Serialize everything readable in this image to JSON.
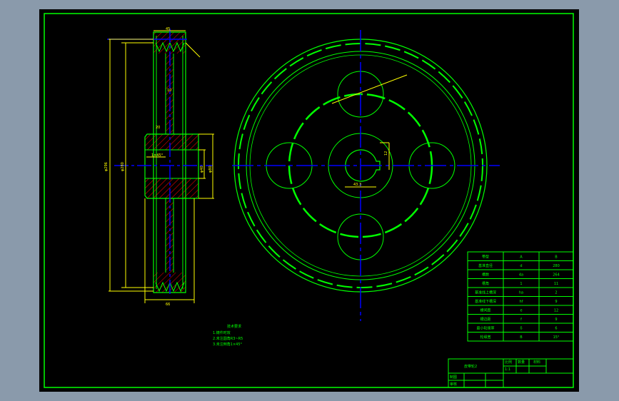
{
  "colors": {
    "background": "#8a9aab",
    "canvas": "#000000",
    "outline": "#00ff00",
    "dimension": "#ffff00",
    "centerline": "#0000ff",
    "hatch": "#ff0000"
  },
  "notes": {
    "title": "技术要求",
    "lines": [
      "1.铸件时效",
      "2.未注圆角R3~R5",
      "3.未注倒角1×45°"
    ]
  },
  "param_table": {
    "rows": [
      [
        "带型",
        "A",
        "B"
      ],
      [
        "基准直径",
        "d",
        "280"
      ],
      [
        "槽数",
        "4a",
        "264"
      ],
      [
        "槽角",
        "1",
        "11"
      ],
      [
        "基准线上槽深",
        "ha",
        "2"
      ],
      [
        "基准线下槽深",
        "hf",
        "9"
      ],
      [
        "槽间距",
        "e",
        "12"
      ],
      [
        "槽边距",
        "f",
        "9"
      ],
      [
        "最小轮缘厚",
        "δ",
        "6"
      ],
      [
        "轮缘宽",
        "B",
        "15°"
      ]
    ]
  },
  "title_block": {
    "name": "皮带轮2",
    "scale_label": "比例",
    "qty_label": "数量",
    "material_label": "材料",
    "scale_value": "1:1",
    "drawn_label": "制图",
    "checked_label": "审核"
  },
  "dims": {
    "hub_len": "45",
    "web": "10",
    "bore": "φ40",
    "keyway": "12",
    "key_depth": "43.3",
    "outer": "φ296",
    "pitch": "φ280",
    "hub_d": "φ80",
    "rim_w": "66",
    "web_gap": "20",
    "chamfer": "1×45°"
  }
}
